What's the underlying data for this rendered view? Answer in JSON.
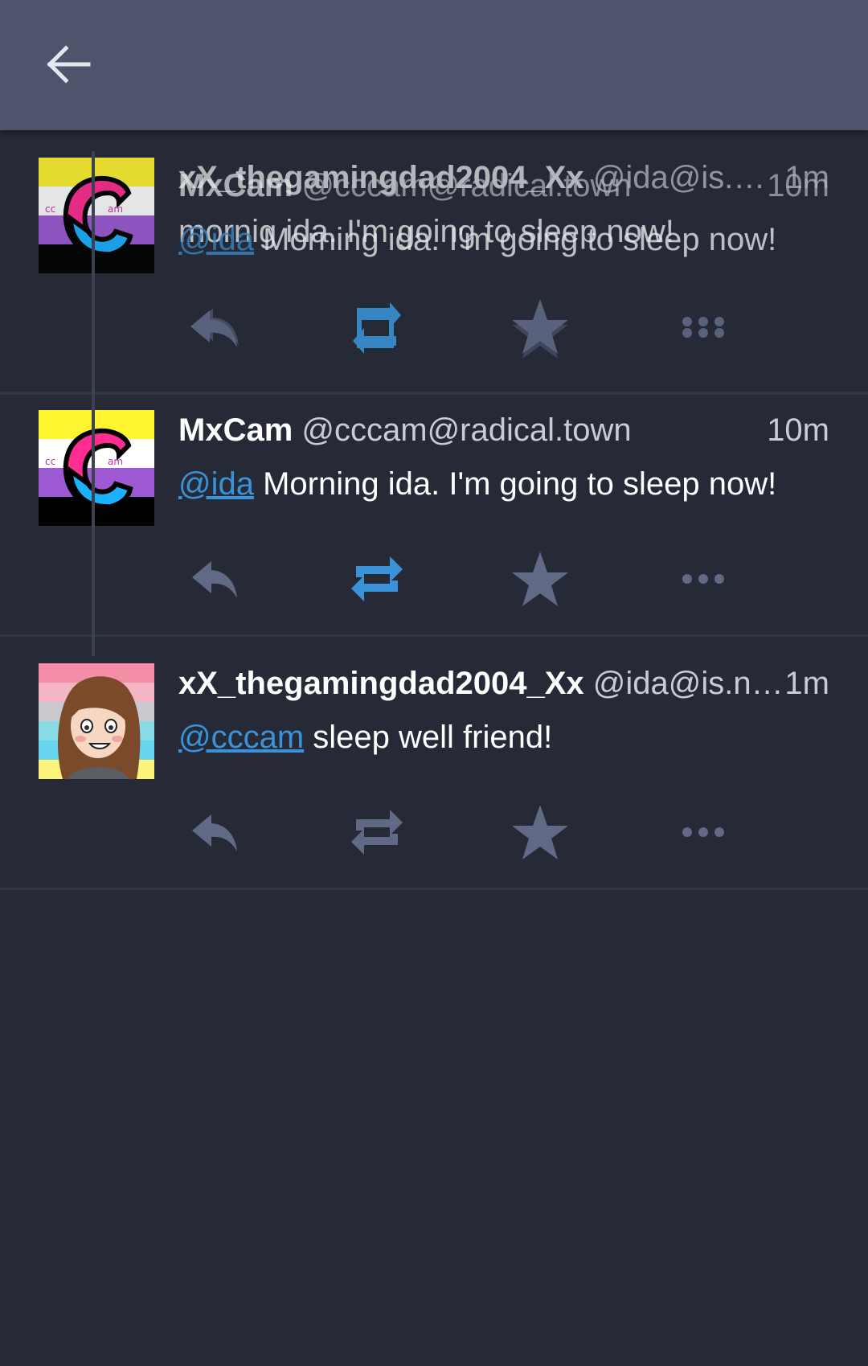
{
  "colors": {
    "appbar": "#4e546b",
    "background": "#262a36",
    "accent": "#3a93d8",
    "icon_muted": "#606a87",
    "divider": "#323747"
  },
  "appbar": {
    "back_icon": "arrow-left-icon"
  },
  "ghost": {
    "name_a": "xX_thegamingdad2004_Xx",
    "acct_a": "@ida@is.…",
    "time_a": "1m",
    "name_b": "MxCam",
    "acct_b": "@cccam@radical.town",
    "time_b": "10m",
    "mention": "@ida",
    "text_a": "mornig ida. I'm going to sleep now!",
    "text_b": "Morning ida. I'm going to sleep now!"
  },
  "statuses": [
    {
      "name": "MxCam",
      "acct": "@cccam@radical.town",
      "time": "10m",
      "mention": "@ida",
      "text": "Morning ida. I'm going to sleep now!",
      "avatar": "cam-pride-avatar",
      "boosted": true
    },
    {
      "name": "xX_thegamingdad2004_Xx",
      "acct": "@ida@is.n…",
      "time": "1m",
      "mention": "@cccam",
      "text": "sleep well friend!",
      "avatar": "ida-drawn-avatar",
      "boosted": false
    }
  ],
  "action_icons": [
    "reply-icon",
    "boost-icon",
    "favourite-icon",
    "more-icon"
  ]
}
